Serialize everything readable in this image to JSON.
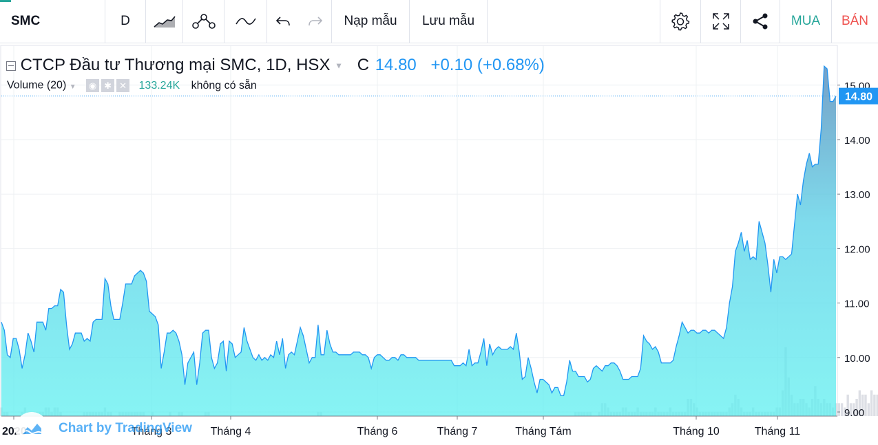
{
  "toolbar": {
    "symbol": "SMC",
    "interval": "D",
    "load_template": "Nạp mẫu",
    "save_template": "Lưu mẫu",
    "buy": "MUA",
    "sell": "BÁN",
    "buy_color": "#26a69a",
    "sell_color": "#ef5350"
  },
  "legend": {
    "title": "CTCP Đầu tư Thương mại SMC, 1D, HSX",
    "close_prefix": "C",
    "close": "14.80",
    "change": "+0.10 (+0.68%)",
    "volume_label": "Volume (20)",
    "volume_value": "133.24K",
    "volume_ma": "không có sẵn"
  },
  "watermark": {
    "text": "Chart by TradingView"
  },
  "colors": {
    "line": "#2196f3",
    "price_label": "#2196f3",
    "volume_bar": "#d1d4dc"
  },
  "chart_data": {
    "type": "area",
    "x_tick_labels": [
      "2020",
      "Tháng 3",
      "Tháng 4",
      "Tháng 6",
      "Tháng 7",
      "Tháng Tám",
      "Tháng 10",
      "Tháng 11"
    ],
    "y_ticks": [
      9.0,
      10.0,
      11.0,
      12.0,
      13.0,
      14.0,
      15.0
    ],
    "y_tick_labels": [
      "9.00",
      "10.00",
      "11.00",
      "12.00",
      "13.00",
      "14.00",
      "15.00"
    ],
    "ylim": [
      9.0,
      15.5
    ],
    "last_price": 14.8,
    "last_price_label": "14.80",
    "series": [
      {
        "values": [
          10.65,
          10.5,
          10.05,
          10.0,
          10.35,
          10.35,
          10.15,
          9.8,
          10.05,
          10.45,
          10.3,
          10.1,
          10.65,
          10.65,
          10.65,
          10.5,
          10.9,
          10.9,
          10.95,
          10.95,
          11.25,
          11.2,
          10.6,
          10.15,
          10.25,
          10.45,
          10.45,
          10.45,
          10.3,
          10.35,
          10.3,
          10.65,
          10.7,
          10.7,
          10.7,
          11.45,
          11.35,
          10.95,
          10.7,
          10.7,
          10.7,
          11.0,
          11.35,
          11.35,
          11.35,
          11.5,
          11.55,
          11.6,
          11.55,
          11.4,
          10.85,
          10.8,
          10.75,
          10.6,
          9.8,
          10.1,
          10.45,
          10.45,
          10.5,
          10.45,
          10.3,
          10.05,
          9.5,
          9.9,
          10.0,
          10.1,
          9.5,
          9.9,
          10.45,
          10.5,
          10.5,
          10.0,
          9.8,
          9.9,
          10.25,
          10.3,
          9.75,
          10.3,
          10.25,
          10.0,
          10.05,
          10.1,
          10.55,
          10.3,
          10.15,
          10.0,
          9.95,
          10.05,
          9.95,
          10.0,
          9.95,
          10.05,
          10.0,
          10.3,
          10.05,
          10.35,
          9.8,
          10.05,
          10.1,
          10.05,
          10.3,
          10.55,
          10.4,
          10.15,
          9.9,
          10.0,
          10.0,
          10.6,
          10.05,
          10.05,
          10.5,
          10.25,
          10.1,
          10.1,
          10.05,
          10.05,
          10.05,
          10.05,
          10.05,
          10.1,
          10.1,
          10.1,
          10.05,
          10.05,
          10.0,
          9.8,
          10.0,
          10.05,
          10.05,
          10.0,
          9.95,
          9.95,
          10.0,
          10.0,
          9.95,
          10.05,
          10.05,
          10.0,
          10.0,
          10.0,
          10.0,
          9.95,
          9.95,
          9.95,
          9.95,
          9.95,
          9.95,
          9.95,
          9.95,
          9.95,
          9.95,
          9.95,
          9.95,
          9.85,
          9.85,
          9.85,
          9.9,
          9.85,
          10.15,
          9.85,
          9.9,
          9.9,
          10.1,
          10.35,
          9.85,
          10.25,
          10.05,
          10.15,
          10.2,
          10.15,
          10.15,
          10.15,
          10.2,
          10.15,
          10.45,
          10.1,
          9.6,
          9.65,
          10.0,
          9.8,
          9.55,
          9.35,
          9.6,
          9.6,
          9.55,
          9.5,
          9.35,
          9.45,
          9.45,
          9.3,
          9.3,
          9.55,
          9.95,
          9.75,
          9.75,
          9.65,
          9.65,
          9.65,
          9.55,
          9.6,
          9.8,
          9.85,
          9.8,
          9.75,
          9.85,
          9.85,
          9.9,
          9.9,
          9.85,
          9.75,
          9.6,
          9.6,
          9.6,
          9.65,
          9.65,
          9.65,
          9.8,
          10.4,
          10.3,
          10.25,
          10.15,
          10.2,
          10.1,
          9.9,
          9.9,
          9.9,
          9.9,
          9.95,
          10.2,
          10.4,
          10.65,
          10.55,
          10.45,
          10.5,
          10.5,
          10.45,
          10.45,
          10.5,
          10.5,
          10.45,
          10.5,
          10.5,
          10.45,
          10.4,
          10.35,
          10.55,
          11.0,
          11.3,
          11.95,
          12.1,
          12.3,
          11.95,
          12.15,
          11.8,
          11.85,
          11.8,
          12.5,
          12.3,
          12.1,
          11.7,
          11.2,
          11.8,
          11.55,
          11.85,
          11.85,
          11.8,
          11.85,
          11.9,
          12.45,
          13.0,
          12.8,
          13.25,
          13.55,
          13.75,
          13.5,
          13.55,
          13.55,
          14.2,
          15.35,
          15.3,
          14.7,
          14.7,
          14.8
        ]
      }
    ],
    "volume": {
      "label": "Volume (20)",
      "values": [
        2,
        1,
        1,
        0,
        0,
        0,
        0,
        1,
        2,
        1,
        1,
        1,
        1,
        1,
        1,
        2,
        2,
        1,
        2,
        2,
        1,
        0,
        0,
        0,
        0,
        0,
        0,
        0,
        1,
        1,
        1,
        1,
        1,
        1,
        1,
        2,
        1,
        1,
        0,
        0,
        1,
        1,
        1,
        1,
        1,
        1,
        1,
        1,
        1,
        0,
        0,
        1,
        0,
        0,
        0,
        0,
        0,
        1,
        0,
        0,
        1,
        1,
        0,
        0,
        0,
        0,
        0,
        0,
        0,
        1,
        1,
        0,
        0,
        0,
        0,
        0,
        0,
        0,
        0,
        0,
        0,
        0,
        0,
        0,
        0,
        0,
        0,
        0,
        0,
        0,
        0,
        0,
        0,
        0,
        0,
        0,
        0,
        0,
        0,
        0,
        0,
        0,
        0,
        0,
        0,
        0,
        0,
        1,
        1,
        0,
        0,
        0,
        0,
        0,
        0,
        0,
        0,
        0,
        0,
        0,
        0,
        0,
        0,
        0,
        0,
        0,
        0,
        0,
        0,
        0,
        0,
        0,
        0,
        0,
        0,
        0,
        0,
        0,
        0,
        0,
        0,
        0,
        0,
        0,
        0,
        0,
        0,
        0,
        0,
        0,
        0,
        0,
        0,
        0,
        0,
        0,
        0,
        0,
        0,
        0,
        0,
        0,
        0,
        0,
        0,
        0,
        0,
        0,
        0,
        0,
        0,
        0,
        0,
        0,
        0,
        0,
        0,
        0,
        0,
        0,
        0,
        0,
        0,
        0,
        0,
        0,
        0,
        0,
        0,
        0,
        0,
        0,
        0,
        0,
        1,
        1,
        1,
        1,
        1,
        1,
        0,
        0,
        1,
        3,
        3,
        2,
        1,
        1,
        1,
        1,
        2,
        2,
        1,
        1,
        1,
        2,
        1,
        1,
        1,
        1,
        1,
        2,
        1,
        1,
        1,
        1,
        2,
        1,
        1,
        1,
        1,
        1,
        4,
        4,
        3,
        2,
        1,
        1,
        1,
        1,
        1,
        1,
        1,
        1,
        1,
        1,
        2,
        3,
        5,
        4,
        2,
        1,
        1,
        1,
        2,
        1,
        1,
        1,
        1,
        1,
        1,
        1,
        2,
        2,
        6,
        16,
        9,
        5,
        3,
        3,
        4,
        4,
        3,
        2,
        4,
        7,
        4,
        3,
        4,
        3,
        3,
        2,
        3,
        3,
        3,
        2,
        5,
        3,
        3,
        4,
        6,
        5,
        5,
        3,
        6,
        5,
        5,
        5,
        3,
        3,
        14,
        12,
        5,
        4,
        4
      ]
    }
  }
}
